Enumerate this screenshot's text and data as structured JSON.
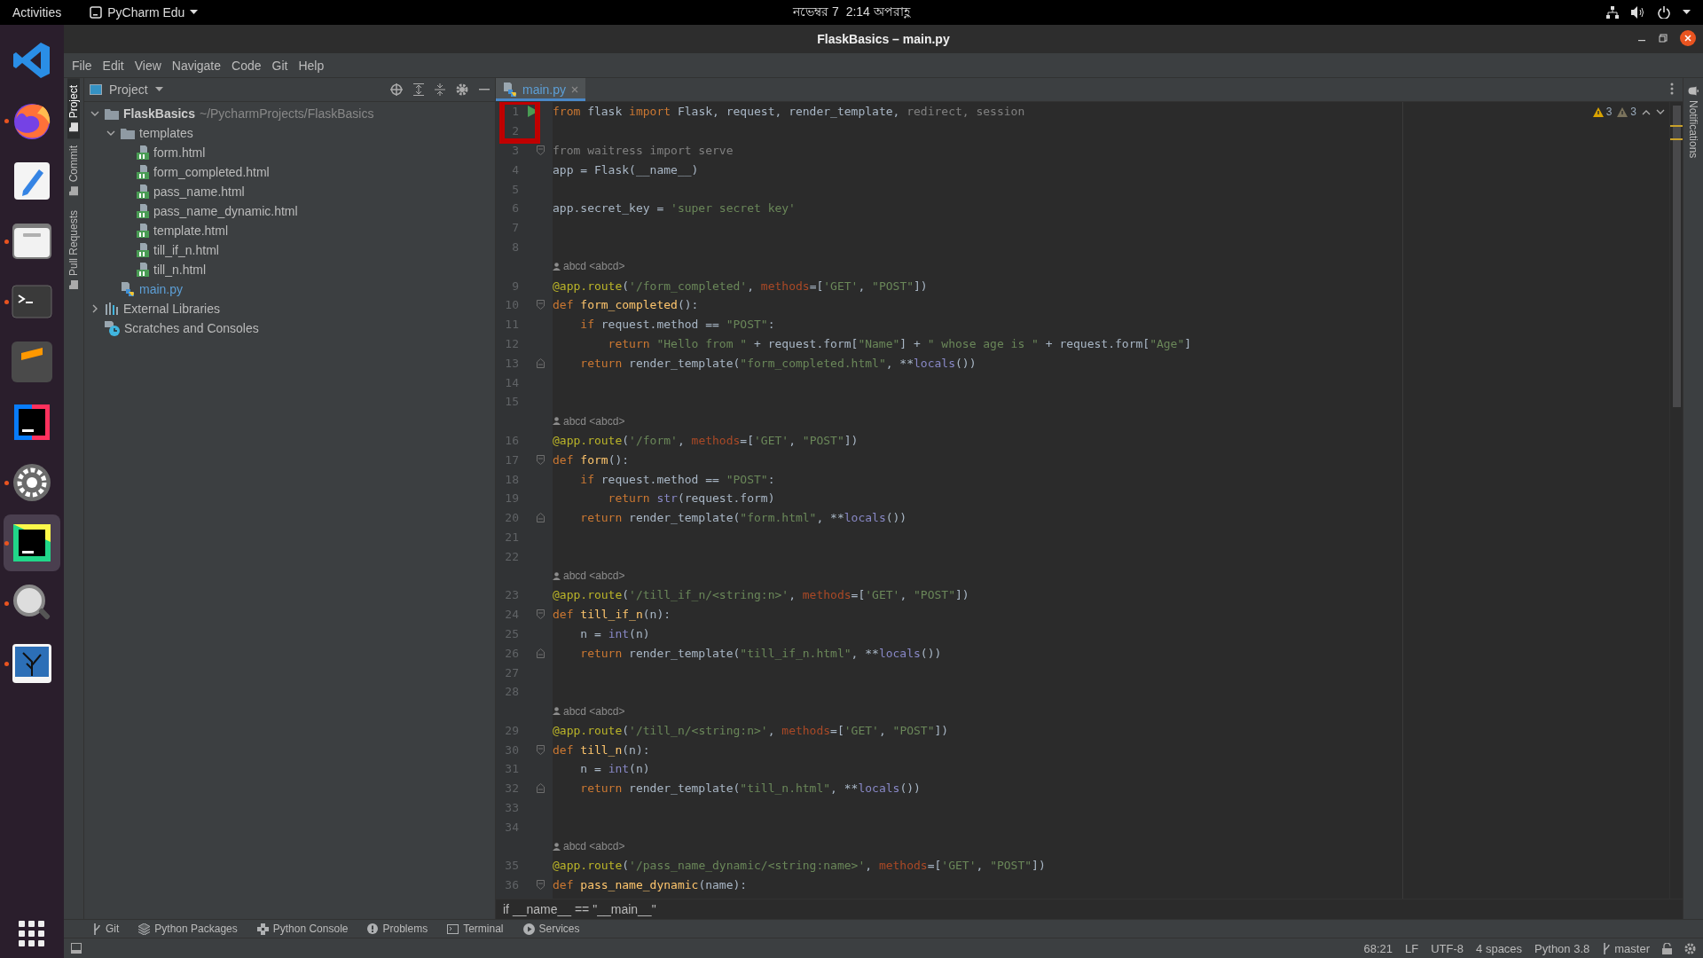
{
  "top_bar": {
    "activities": "Activities",
    "app_menu": "PyCharm Edu",
    "clock": "নভেম্বর 7  2:14 অপরাহ্ণ"
  },
  "dock": [
    {
      "kind": "code-editor",
      "running": false,
      "selected": false
    },
    {
      "kind": "browser",
      "running": true,
      "selected": false
    },
    {
      "kind": "text-editor",
      "running": false,
      "selected": false
    },
    {
      "kind": "files",
      "running": true,
      "selected": false
    },
    {
      "kind": "terminal",
      "running": true,
      "selected": false
    },
    {
      "kind": "stripes",
      "running": false,
      "selected": false
    },
    {
      "kind": "ide",
      "running": false,
      "selected": false
    },
    {
      "kind": "settings",
      "running": true,
      "selected": false
    },
    {
      "kind": "ide-green",
      "running": true,
      "selected": true
    },
    {
      "kind": "magnifier",
      "running": true,
      "selected": false
    },
    {
      "kind": "landscape",
      "running": true,
      "selected": false
    }
  ],
  "window": {
    "title": "FlaskBasics – main.py"
  },
  "menu": [
    "File",
    "Edit",
    "View",
    "Navigate",
    "Code",
    "Git",
    "Help"
  ],
  "tool_stripe": [
    {
      "label": "Project",
      "selected": true
    },
    {
      "label": "Commit",
      "selected": false
    },
    {
      "label": "Pull Requests",
      "selected": false
    }
  ],
  "project_panel": {
    "title": "Project",
    "tree": [
      {
        "label": "FlaskBasics",
        "path": "~/PycharmProjects/FlaskBasics",
        "kind": "folder",
        "expanded": true,
        "children": [
          {
            "label": "templates",
            "kind": "folder",
            "expanded": true,
            "children": [
              {
                "label": "form.html",
                "kind": "html"
              },
              {
                "label": "form_completed.html",
                "kind": "html"
              },
              {
                "label": "pass_name.html",
                "kind": "html"
              },
              {
                "label": "pass_name_dynamic.html",
                "kind": "html"
              },
              {
                "label": "template.html",
                "kind": "html"
              },
              {
                "label": "till_if_n.html",
                "kind": "html"
              },
              {
                "label": "till_n.html",
                "kind": "html"
              }
            ]
          },
          {
            "label": "main.py",
            "kind": "python"
          }
        ]
      },
      {
        "label": "External Libraries",
        "kind": "libraries",
        "expanded": false
      },
      {
        "label": "Scratches and Consoles",
        "kind": "scratches"
      }
    ]
  },
  "editor": {
    "tabs": [
      {
        "label": "main.py",
        "selected": true
      }
    ],
    "inspections": {
      "warnings": "3",
      "weak_warnings": "3"
    },
    "lines": [
      {
        "kind": "code",
        "number": "1",
        "gutter_icon": {
          "kind": "run"
        },
        "tokens": [
          {
            "kind": "kw",
            "text": "from"
          },
          {
            "kind": "plain",
            "text": " flask "
          },
          {
            "kind": "kw",
            "text": "import"
          },
          {
            "kind": "plain",
            "text": " Flask, request, render_template, "
          },
          {
            "kind": "dim",
            "text": "redirect, session"
          }
        ]
      },
      {
        "kind": "code",
        "number": "2"
      },
      {
        "kind": "code",
        "number": "3",
        "gutter_icon": {
          "kind": "fold"
        },
        "tokens": [
          {
            "kind": "dim",
            "text": "from waitress import serve"
          }
        ]
      },
      {
        "kind": "code",
        "number": "4",
        "tokens": [
          {
            "kind": "plain",
            "text": "app = Flask(__name__)"
          }
        ]
      },
      {
        "kind": "code",
        "number": "5"
      },
      {
        "kind": "code",
        "number": "6",
        "tokens": [
          {
            "kind": "plain",
            "text": "app.secret_key = "
          },
          {
            "kind": "str",
            "text": "'super secret key'"
          }
        ]
      },
      {
        "kind": "code",
        "number": "7"
      },
      {
        "kind": "code",
        "number": "8"
      },
      {
        "kind": "author",
        "text": "abcd <abcd>"
      },
      {
        "kind": "code",
        "number": "9",
        "tokens": [
          {
            "kind": "dec",
            "text": "@app.route"
          },
          {
            "kind": "plain",
            "text": "("
          },
          {
            "kind": "str",
            "text": "'/form_completed'"
          },
          {
            "kind": "plain",
            "text": ", "
          },
          {
            "kind": "param",
            "text": "methods"
          },
          {
            "kind": "plain",
            "text": "=["
          },
          {
            "kind": "str",
            "text": "'GET'"
          },
          {
            "kind": "plain",
            "text": ", "
          },
          {
            "kind": "str",
            "text": "\"POST\""
          },
          {
            "kind": "plain",
            "text": "])"
          }
        ]
      },
      {
        "kind": "code",
        "number": "10",
        "gutter_icon": {
          "kind": "fold"
        },
        "tokens": [
          {
            "kind": "kw",
            "text": "def"
          },
          {
            "kind": "fn",
            "text": " form_completed"
          },
          {
            "kind": "plain",
            "text": "():"
          }
        ]
      },
      {
        "kind": "code",
        "number": "11",
        "tokens": [
          {
            "kind": "kw",
            "text": "    if"
          },
          {
            "kind": "plain",
            "text": " request.method == "
          },
          {
            "kind": "str",
            "text": "\"POST\""
          },
          {
            "kind": "plain",
            "text": ":"
          }
        ]
      },
      {
        "kind": "code",
        "number": "12",
        "tokens": [
          {
            "kind": "kw",
            "text": "        return"
          },
          {
            "kind": "str",
            "text": " \"Hello from \""
          },
          {
            "kind": "plain",
            "text": " + request.form["
          },
          {
            "kind": "str",
            "text": "\"Name\""
          },
          {
            "kind": "plain",
            "text": "] + "
          },
          {
            "kind": "str",
            "text": "\" whose age is \""
          },
          {
            "kind": "plain",
            "text": " + request.form["
          },
          {
            "kind": "str",
            "text": "\"Age\""
          },
          {
            "kind": "plain",
            "text": "]"
          }
        ]
      },
      {
        "kind": "code",
        "number": "13",
        "gutter_icon": {
          "kind": "fold-end"
        },
        "tokens": [
          {
            "kind": "kw",
            "text": "    return"
          },
          {
            "kind": "plain",
            "text": " render_template("
          },
          {
            "kind": "str",
            "text": "\"form_completed.html\""
          },
          {
            "kind": "plain",
            "text": ", **"
          },
          {
            "kind": "builtin",
            "text": "locals"
          },
          {
            "kind": "plain",
            "text": "())"
          }
        ]
      },
      {
        "kind": "code",
        "number": "14"
      },
      {
        "kind": "code",
        "number": "15"
      },
      {
        "kind": "author",
        "text": "abcd <abcd>"
      },
      {
        "kind": "code",
        "number": "16",
        "tokens": [
          {
            "kind": "dec",
            "text": "@app.route"
          },
          {
            "kind": "plain",
            "text": "("
          },
          {
            "kind": "str",
            "text": "'/form'"
          },
          {
            "kind": "plain",
            "text": ", "
          },
          {
            "kind": "param",
            "text": "methods"
          },
          {
            "kind": "plain",
            "text": "=["
          },
          {
            "kind": "str",
            "text": "'GET'"
          },
          {
            "kind": "plain",
            "text": ", "
          },
          {
            "kind": "str",
            "text": "\"POST\""
          },
          {
            "kind": "plain",
            "text": "])"
          }
        ]
      },
      {
        "kind": "code",
        "number": "17",
        "gutter_icon": {
          "kind": "fold"
        },
        "tokens": [
          {
            "kind": "kw",
            "text": "def"
          },
          {
            "kind": "fn",
            "text": " form"
          },
          {
            "kind": "plain",
            "text": "():"
          }
        ]
      },
      {
        "kind": "code",
        "number": "18",
        "tokens": [
          {
            "kind": "kw",
            "text": "    if"
          },
          {
            "kind": "plain",
            "text": " request.method == "
          },
          {
            "kind": "str",
            "text": "\"POST\""
          },
          {
            "kind": "plain",
            "text": ":"
          }
        ]
      },
      {
        "kind": "code",
        "number": "19",
        "tokens": [
          {
            "kind": "kw",
            "text": "        return"
          },
          {
            "kind": "builtin",
            "text": " str"
          },
          {
            "kind": "plain",
            "text": "(request.form)"
          }
        ]
      },
      {
        "kind": "code",
        "number": "20",
        "gutter_icon": {
          "kind": "fold-end"
        },
        "tokens": [
          {
            "kind": "kw",
            "text": "    return"
          },
          {
            "kind": "plain",
            "text": " render_template("
          },
          {
            "kind": "str",
            "text": "\"form.html\""
          },
          {
            "kind": "plain",
            "text": ", **"
          },
          {
            "kind": "builtin",
            "text": "locals"
          },
          {
            "kind": "plain",
            "text": "())"
          }
        ]
      },
      {
        "kind": "code",
        "number": "21"
      },
      {
        "kind": "code",
        "number": "22"
      },
      {
        "kind": "author",
        "text": "abcd <abcd>"
      },
      {
        "kind": "code",
        "number": "23",
        "tokens": [
          {
            "kind": "dec",
            "text": "@app.route"
          },
          {
            "kind": "plain",
            "text": "("
          },
          {
            "kind": "str",
            "text": "'/till_if_n/<string:n>'"
          },
          {
            "kind": "plain",
            "text": ", "
          },
          {
            "kind": "param",
            "text": "methods"
          },
          {
            "kind": "plain",
            "text": "=["
          },
          {
            "kind": "str",
            "text": "'GET'"
          },
          {
            "kind": "plain",
            "text": ", "
          },
          {
            "kind": "str",
            "text": "\"POST\""
          },
          {
            "kind": "plain",
            "text": "])"
          }
        ]
      },
      {
        "kind": "code",
        "number": "24",
        "gutter_icon": {
          "kind": "fold"
        },
        "tokens": [
          {
            "kind": "kw",
            "text": "def"
          },
          {
            "kind": "fn",
            "text": " till_if_n"
          },
          {
            "kind": "plain",
            "text": "(n):"
          }
        ]
      },
      {
        "kind": "code",
        "number": "25",
        "tokens": [
          {
            "kind": "plain",
            "text": "    n = "
          },
          {
            "kind": "builtin",
            "text": "int"
          },
          {
            "kind": "plain",
            "text": "(n)"
          }
        ]
      },
      {
        "kind": "code",
        "number": "26",
        "gutter_icon": {
          "kind": "fold-end"
        },
        "tokens": [
          {
            "kind": "kw",
            "text": "    return"
          },
          {
            "kind": "plain",
            "text": " render_template("
          },
          {
            "kind": "str",
            "text": "\"till_if_n.html\""
          },
          {
            "kind": "plain",
            "text": ", **"
          },
          {
            "kind": "builtin",
            "text": "locals"
          },
          {
            "kind": "plain",
            "text": "())"
          }
        ]
      },
      {
        "kind": "code",
        "number": "27"
      },
      {
        "kind": "code",
        "number": "28"
      },
      {
        "kind": "author",
        "text": "abcd <abcd>"
      },
      {
        "kind": "code",
        "number": "29",
        "tokens": [
          {
            "kind": "dec",
            "text": "@app.route"
          },
          {
            "kind": "plain",
            "text": "("
          },
          {
            "kind": "str",
            "text": "'/till_n/<string:n>'"
          },
          {
            "kind": "plain",
            "text": ", "
          },
          {
            "kind": "param",
            "text": "methods"
          },
          {
            "kind": "plain",
            "text": "=["
          },
          {
            "kind": "str",
            "text": "'GET'"
          },
          {
            "kind": "plain",
            "text": ", "
          },
          {
            "kind": "str",
            "text": "\"POST\""
          },
          {
            "kind": "plain",
            "text": "])"
          }
        ]
      },
      {
        "kind": "code",
        "number": "30",
        "gutter_icon": {
          "kind": "fold"
        },
        "tokens": [
          {
            "kind": "kw",
            "text": "def"
          },
          {
            "kind": "fn",
            "text": " till_n"
          },
          {
            "kind": "plain",
            "text": "(n):"
          }
        ]
      },
      {
        "kind": "code",
        "number": "31",
        "tokens": [
          {
            "kind": "plain",
            "text": "    n = "
          },
          {
            "kind": "builtin",
            "text": "int"
          },
          {
            "kind": "plain",
            "text": "(n)"
          }
        ]
      },
      {
        "kind": "code",
        "number": "32",
        "gutter_icon": {
          "kind": "fold-end"
        },
        "tokens": [
          {
            "kind": "kw",
            "text": "    return"
          },
          {
            "kind": "plain",
            "text": " render_template("
          },
          {
            "kind": "str",
            "text": "\"till_n.html\""
          },
          {
            "kind": "plain",
            "text": ", **"
          },
          {
            "kind": "builtin",
            "text": "locals"
          },
          {
            "kind": "plain",
            "text": "())"
          }
        ]
      },
      {
        "kind": "code",
        "number": "33"
      },
      {
        "kind": "code",
        "number": "34"
      },
      {
        "kind": "author",
        "text": "abcd <abcd>"
      },
      {
        "kind": "code",
        "number": "35",
        "tokens": [
          {
            "kind": "dec",
            "text": "@app.route"
          },
          {
            "kind": "plain",
            "text": "("
          },
          {
            "kind": "str",
            "text": "'/pass_name_dynamic/<string:name>'"
          },
          {
            "kind": "plain",
            "text": ", "
          },
          {
            "kind": "param",
            "text": "methods"
          },
          {
            "kind": "plain",
            "text": "=["
          },
          {
            "kind": "str",
            "text": "'GET'"
          },
          {
            "kind": "plain",
            "text": ", "
          },
          {
            "kind": "str",
            "text": "\"POST\""
          },
          {
            "kind": "plain",
            "text": "])"
          }
        ]
      },
      {
        "kind": "code",
        "number": "36",
        "gutter_icon": {
          "kind": "fold"
        },
        "tokens": [
          {
            "kind": "kw",
            "text": "def"
          },
          {
            "kind": "fn",
            "text": " pass_name_dynamic"
          },
          {
            "kind": "plain",
            "text": "(name):"
          }
        ]
      }
    ],
    "breadcrumb": "if __name__ == \"__main__\""
  },
  "notifications": "Notifications",
  "tool_windows": [
    {
      "kind": "git",
      "label": "Git"
    },
    {
      "kind": "packages",
      "label": "Python Packages"
    },
    {
      "kind": "console",
      "label": "Python Console"
    },
    {
      "kind": "problems",
      "label": "Problems"
    },
    {
      "kind": "terminal",
      "label": "Terminal"
    },
    {
      "kind": "services",
      "label": "Services"
    }
  ],
  "status_bar": {
    "position": "68:21",
    "line_separator": "LF",
    "encoding": "UTF-8",
    "indent": "4 spaces",
    "interpreter": "Python 3.8",
    "branch": "master"
  }
}
